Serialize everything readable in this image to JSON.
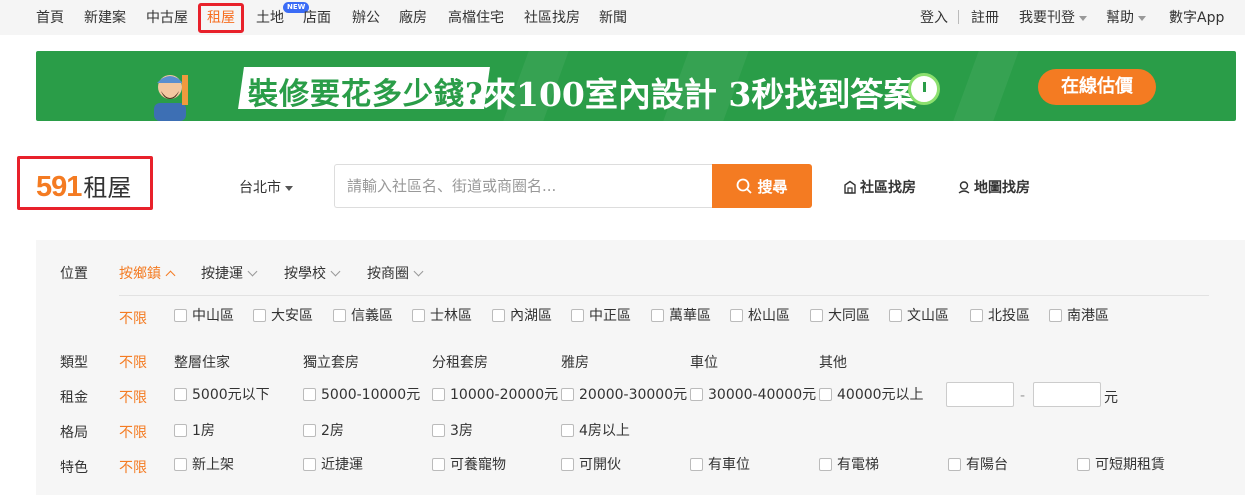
{
  "topnav": {
    "left": [
      "首頁",
      "新建案",
      "中古屋",
      "租屋",
      "土地",
      "店面",
      "辦公",
      "廠房",
      "高檔住宅",
      "社區找房",
      "新聞"
    ],
    "new_badge": "NEW",
    "right": [
      "登入",
      "註冊",
      "我要刊登",
      "幫助",
      "數字App"
    ]
  },
  "banner": {
    "question": "裝修要花多少錢?",
    "headline": "來100室內設計  3秒找到答案",
    "cta": "在線估價"
  },
  "logo": {
    "number": "591",
    "text": "租屋"
  },
  "search": {
    "city": "台北市",
    "placeholder": "請輸入社區名、街道或商圈名...",
    "button": "搜尋",
    "links": [
      "社區找房",
      "地圖找房"
    ]
  },
  "filters": {
    "location": {
      "label": "位置",
      "tabs": [
        "按鄉鎮",
        "按捷運",
        "按學校",
        "按商圈"
      ],
      "unlimited": "不限",
      "districts": [
        "中山區",
        "大安區",
        "信義區",
        "士林區",
        "內湖區",
        "中正區",
        "萬華區",
        "松山區",
        "大同區",
        "文山區",
        "北投區",
        "南港區"
      ]
    },
    "type": {
      "label": "類型",
      "unlimited": "不限",
      "options": [
        "整層住家",
        "獨立套房",
        "分租套房",
        "雅房",
        "車位",
        "其他"
      ]
    },
    "rent": {
      "label": "租金",
      "unlimited": "不限",
      "options": [
        "5000元以下",
        "5000-10000元",
        "10000-20000元",
        "20000-30000元",
        "30000-40000元",
        "40000元以上"
      ],
      "range_separator": "-",
      "unit": "元"
    },
    "layout": {
      "label": "格局",
      "unlimited": "不限",
      "options": [
        "1房",
        "2房",
        "3房",
        "4房以上"
      ]
    },
    "feature": {
      "label": "特色",
      "unlimited": "不限",
      "options": [
        "新上架",
        "近捷運",
        "可養寵物",
        "可開伙",
        "有車位",
        "有電梯",
        "有陽台",
        "可短期租賃"
      ]
    }
  },
  "colors": {
    "accent": "#f47b22",
    "highlight_border": "#e8212b",
    "banner_green": "#2a9d48"
  }
}
